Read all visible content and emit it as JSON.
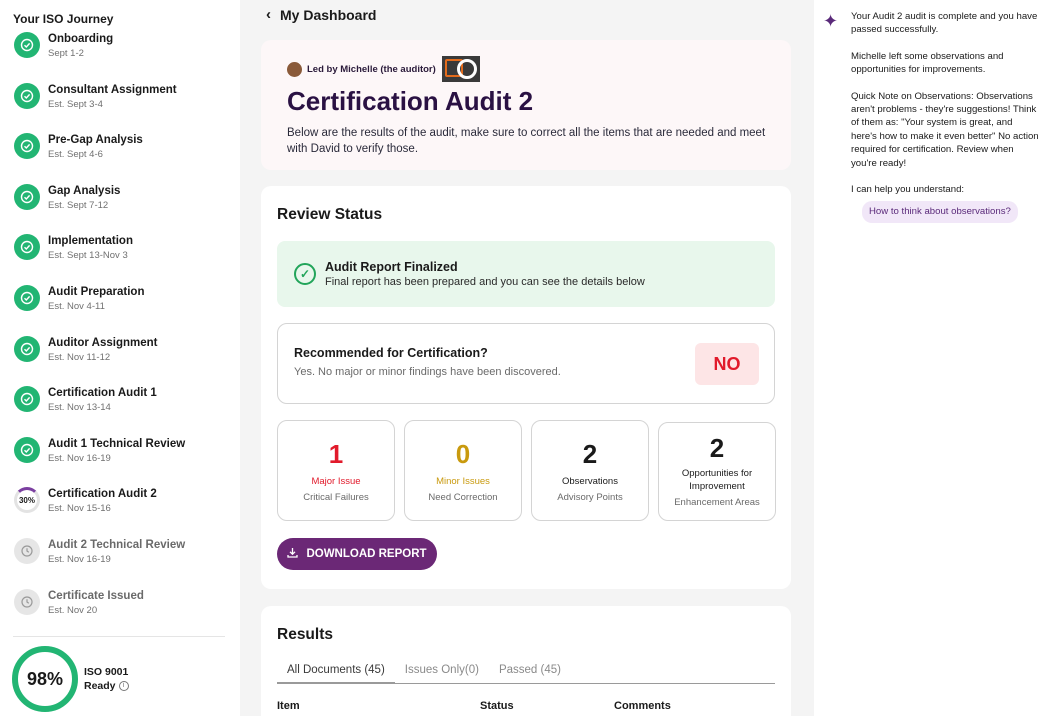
{
  "sidebar": {
    "title": "Your ISO Journey",
    "steps": [
      {
        "name": "Onboarding",
        "date": "Sept 1-2",
        "state": "done"
      },
      {
        "name": "Consultant Assignment",
        "date": "Est. Sept 3-4",
        "state": "done"
      },
      {
        "name": "Pre-Gap Analysis",
        "date": "Est. Sept 4-6",
        "state": "done"
      },
      {
        "name": "Gap Analysis",
        "date": "Est. Sept 7-12",
        "state": "done"
      },
      {
        "name": "Implementation",
        "date": "Est. Sept 13-Nov 3",
        "state": "done"
      },
      {
        "name": "Audit Preparation",
        "date": "Est. Nov 4-11",
        "state": "done"
      },
      {
        "name": "Auditor Assignment",
        "date": "Est. Nov 11-12",
        "state": "done"
      },
      {
        "name": "Certification Audit 1",
        "date": "Est. Nov 13-14",
        "state": "done"
      },
      {
        "name": "Audit 1 Technical Review",
        "date": "Est. Nov 16-19",
        "state": "done"
      },
      {
        "name": "Certification Audit 2",
        "date": "Est. Nov 15-16",
        "state": "current",
        "progress": "30%"
      },
      {
        "name": "Audit 2 Technical Review",
        "date": "Est. Nov 16-19",
        "state": "pending"
      },
      {
        "name": "Certificate Issued",
        "date": "Est. Nov 20",
        "state": "pending"
      }
    ],
    "readiness": {
      "percent": "98%",
      "label_line1": "ISO 9001",
      "label_line2": "Ready"
    }
  },
  "header": {
    "back_label": "My Dashboard"
  },
  "hero": {
    "led_by": "Led by Michelle (the auditor)",
    "title": "Certification Audit 2",
    "description": "Below are the results of the audit, make sure to correct all the items that are needed and meet with David to verify those."
  },
  "review": {
    "title": "Review Status",
    "finalized_title": "Audit Report Finalized",
    "finalized_desc": "Final report has been prepared and you can see the details below",
    "recommend_question": "Recommended for Certification?",
    "recommend_answer": "Yes. No major or minor findings have been discovered.",
    "recommend_badge": "NO",
    "stats": [
      {
        "num": "1",
        "label": "Major Issue",
        "sub": "Critical Failures",
        "color": "#e11a2b"
      },
      {
        "num": "0",
        "label": "Minor Issues",
        "sub": "Need Correction",
        "color": "#c99a0e"
      },
      {
        "num": "2",
        "label": "Observations",
        "sub": "Advisory Points",
        "color": "#1a1a1a"
      },
      {
        "num": "2",
        "label": "Opportunities for Improvement",
        "sub": "Enhancement Areas",
        "color": "#1a1a1a"
      }
    ],
    "download_label": "DOWNLOAD REPORT"
  },
  "results": {
    "title": "Results",
    "tabs": [
      "All Documents (45)",
      "Issues Only(0)",
      "Passed (45)"
    ],
    "columns": [
      "Item",
      "Status",
      "Comments"
    ]
  },
  "chat": {
    "messages": [
      "Your Audit 2 audit is complete and you have passed successfully.",
      "Michelle left some observations and opportunities for improvements.",
      "Quick Note on Observations: Observations aren't problems - they're suggestions! Think of them as: \"Your system is great, and here's how to make it even better\" No action required for certification. Review when you're ready!",
      "I can help you understand:"
    ],
    "suggestion": "How to think about observations?"
  },
  "colors": {
    "accent": "#6b2876",
    "success": "#22b573",
    "danger": "#e11a2b"
  }
}
